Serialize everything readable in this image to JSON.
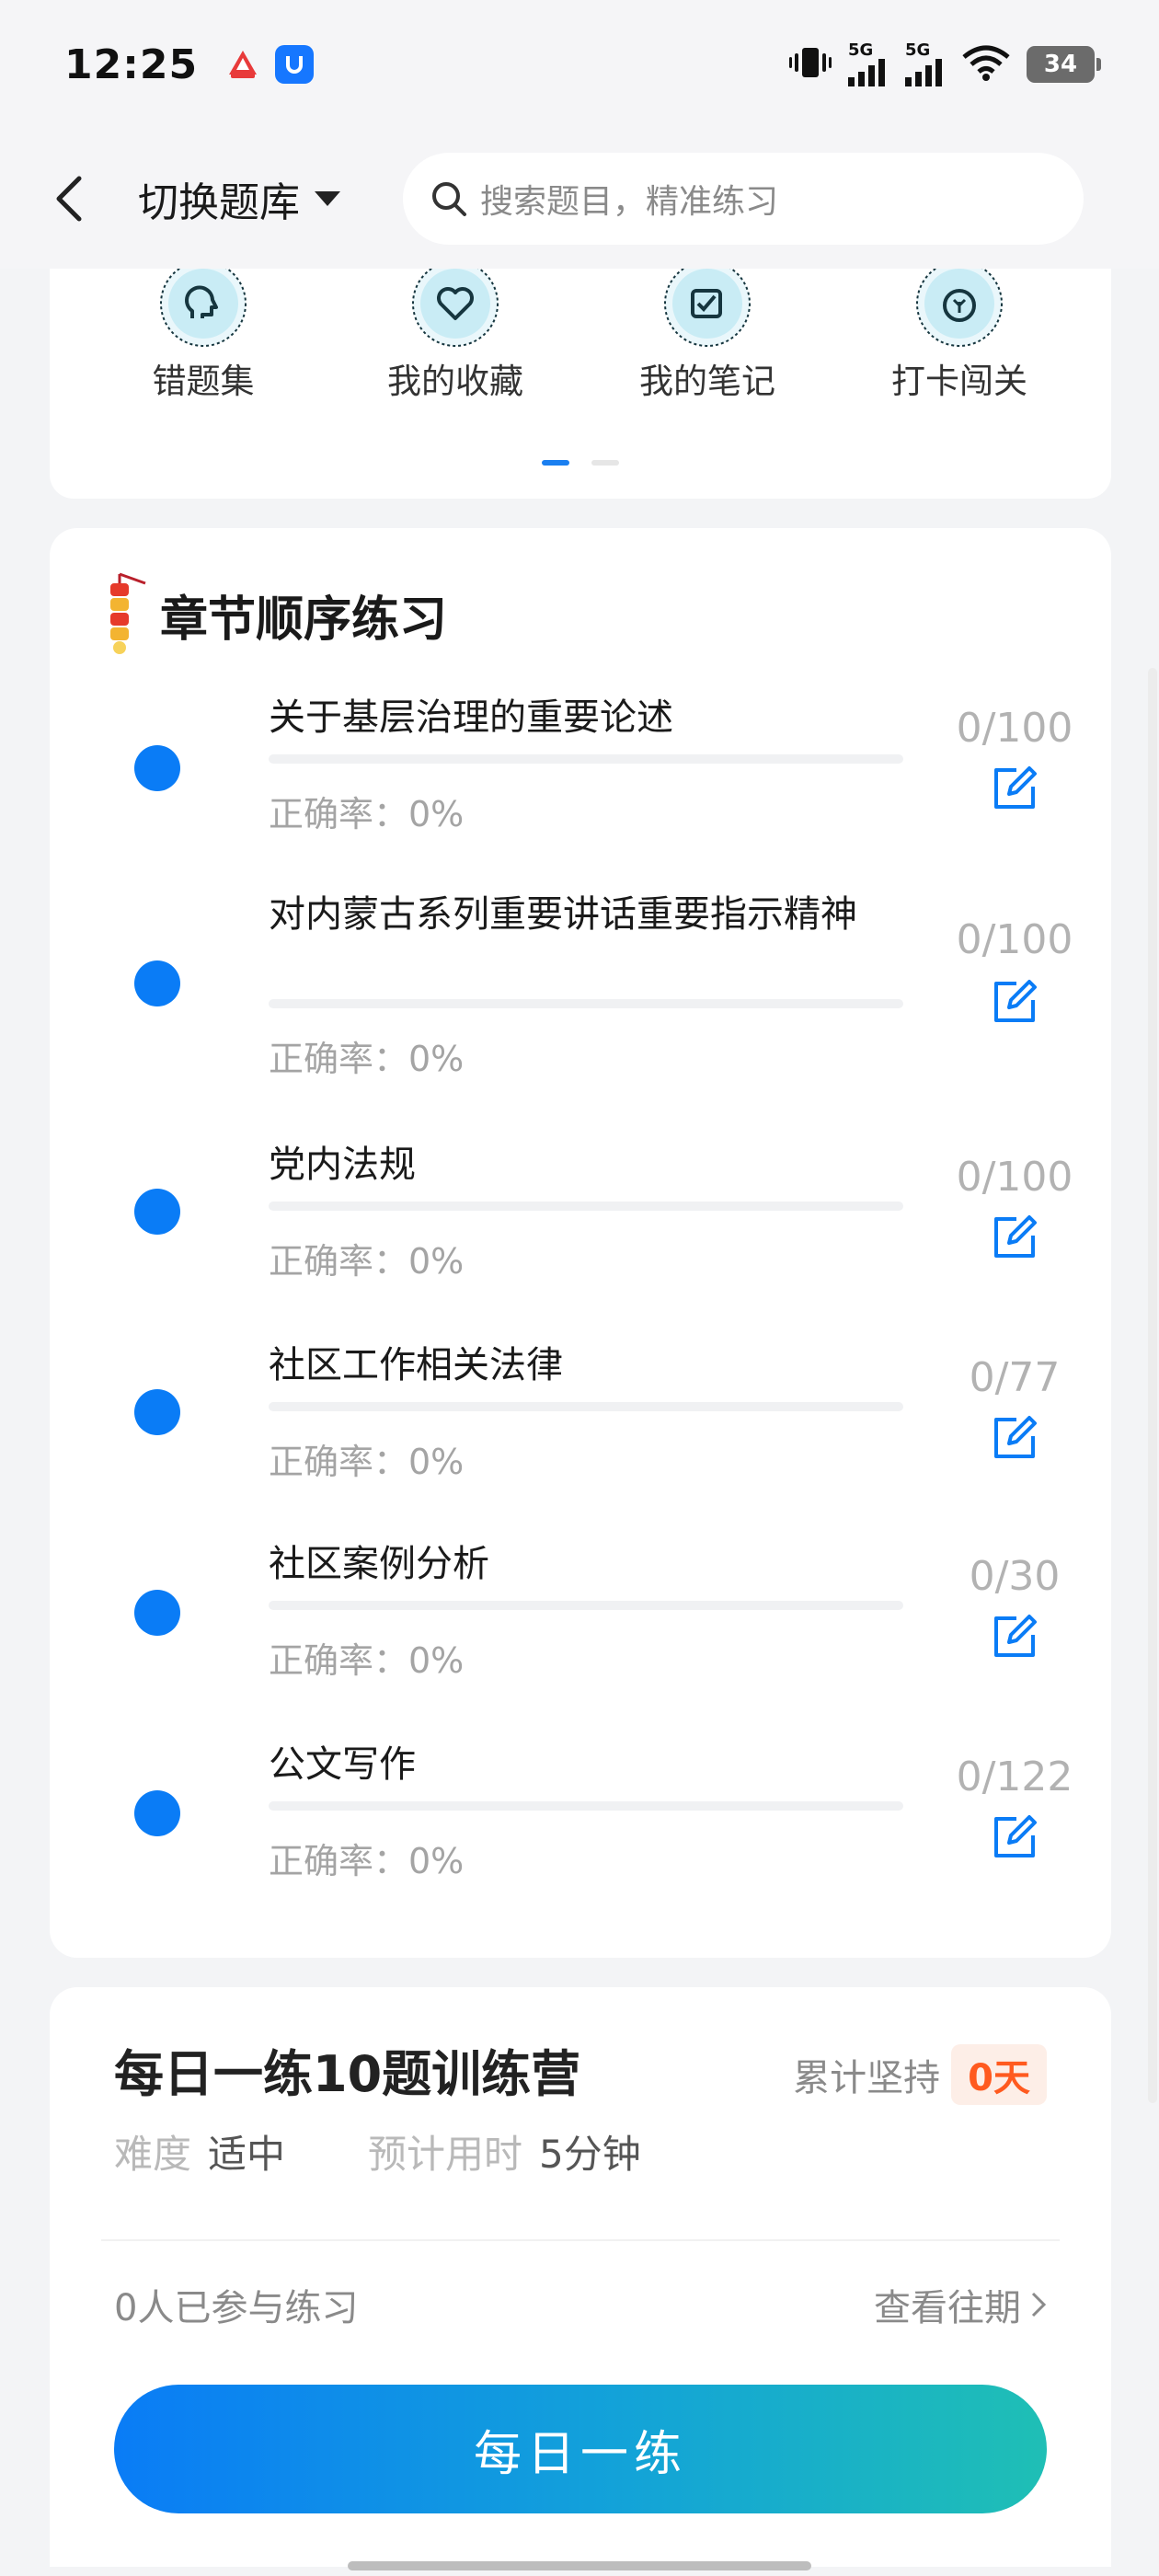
{
  "status_bar": {
    "time": "12:25",
    "signal1_label": "5G",
    "signal2_label": "5G",
    "battery": "34"
  },
  "header": {
    "switch_bank_label": "切换题库",
    "search_placeholder": "搜索题目，精准练习"
  },
  "shortcuts": [
    {
      "label": "错题集",
      "icon": "head-icon"
    },
    {
      "label": "我的收藏",
      "icon": "heart-icon"
    },
    {
      "label": "我的笔记",
      "icon": "checkbox-icon"
    },
    {
      "label": "打卡闯关",
      "icon": "leaf-icon"
    }
  ],
  "chapters": {
    "title": "章节顺序练习",
    "items": [
      {
        "name": "关于基层治理的重要论述",
        "accuracy": "正确率：0%",
        "count": "0/100"
      },
      {
        "name": "对内蒙古系列重要讲话重要指示精神",
        "accuracy": "正确率：0%",
        "count": "0/100"
      },
      {
        "name": "党内法规",
        "accuracy": "正确率：0%",
        "count": "0/100"
      },
      {
        "name": "社区工作相关法律",
        "accuracy": "正确率：0%",
        "count": "0/77"
      },
      {
        "name": "社区案例分析",
        "accuracy": "正确率：0%",
        "count": "0/30"
      },
      {
        "name": "公文写作",
        "accuracy": "正确率：0%",
        "count": "0/122"
      }
    ]
  },
  "daily": {
    "title": "每日一练10题训练营",
    "streak_label": "累计坚持",
    "streak_value": "0天",
    "difficulty_key": "难度",
    "difficulty_value": "适中",
    "time_key": "预计用时",
    "time_value": "5分钟",
    "participants": "0人已参与练习",
    "history_link": "查看往期",
    "button_label": "每日一练"
  },
  "colors": {
    "accent": "#0a7cf6",
    "streak": "#ff5a1f",
    "button_gradient_end": "#1fbfb5"
  }
}
